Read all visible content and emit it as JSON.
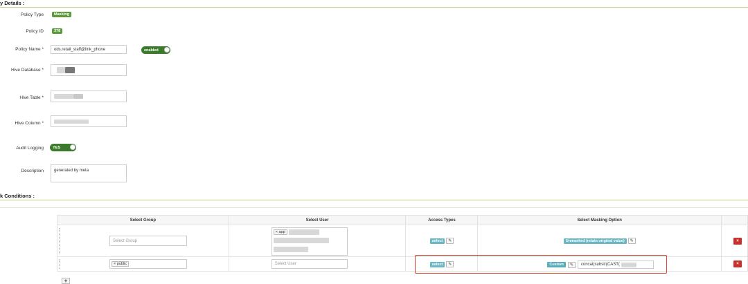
{
  "sections": {
    "policy_details_title": "y Details :",
    "conditions_title": "k Conditions :"
  },
  "form": {
    "policy_type_label": "Policy Type",
    "policy_type_value": "Masking",
    "policy_id_label": "Policy ID",
    "policy_id_value": "378",
    "policy_name_label": "Policy Name *",
    "policy_name_value": "ods.retail_staff@link_phone",
    "enabled_label": "enabled",
    "hive_database_label": "Hive Database *",
    "hive_table_label": "Hive Table *",
    "hive_column_label": "Hive Column *",
    "audit_logging_label": "Audit Logging",
    "audit_logging_value": "YES",
    "description_label": "Description",
    "description_value": "generated by meta"
  },
  "table": {
    "headers": [
      "Select Group",
      "Select User",
      "Access Types",
      "Select Masking Option"
    ],
    "rows": [
      {
        "group_placeholder": "Select Group",
        "user_tag": "app",
        "access": "select",
        "masking": "Unmasked (retain original value)"
      },
      {
        "group_tag": "public",
        "user_placeholder": "Select User",
        "access": "select",
        "masking": "Custom",
        "custom_expr": "concat(substr(CAST("
      }
    ],
    "delete_symbol": "×",
    "remove_symbol": "×",
    "add_symbol": "+",
    "pencil_symbol": "✎"
  },
  "colors": {
    "badge_green": "#5a9a3a",
    "toggle_green": "#3c7a2c",
    "teal": "#6ab8c4",
    "danger": "#c9302c",
    "highlight": "#e0442c"
  }
}
